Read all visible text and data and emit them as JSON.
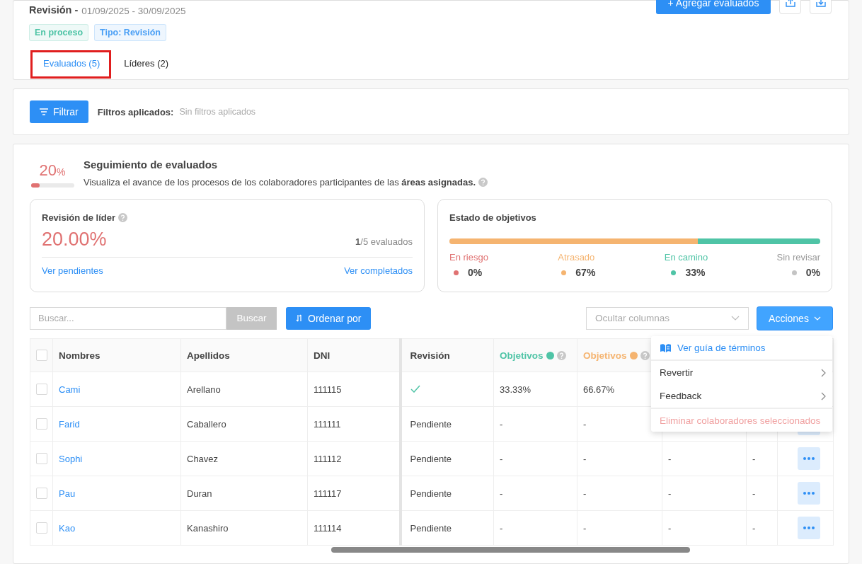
{
  "header": {
    "title": "Revisión -",
    "period": "01/09/2025 - 30/09/2025",
    "add_button": "+ Agregar evaluados"
  },
  "tags": [
    {
      "label": "En proceso",
      "color": "#4fc4a6"
    },
    {
      "label": "Tipo: Revisión",
      "color": "#4a9ff5"
    }
  ],
  "tabs": [
    {
      "label": "Evaluados (5)",
      "selected": true,
      "highlighted": true
    },
    {
      "label": "Líderes (2)",
      "selected": false,
      "highlighted": false
    }
  ],
  "filter": {
    "button": "Filtrar",
    "label": "Filtros aplicados:",
    "value": "Sin filtros aplicados"
  },
  "tracking": {
    "percent": "20",
    "percent_sign": "%",
    "level": 0.2,
    "title": "Seguimiento de evaluados",
    "description": "Visualiza el avance de los procesos de los colaboradores participantes de las **áreas asignadas.**"
  },
  "review_card": {
    "title": "Revisión de líder",
    "value": "20.00%",
    "count": "**1**/5 evaluados",
    "links": [
      "Ver pendientes",
      "Ver completados"
    ]
  },
  "objectives_card": {
    "title": "Estado de objetivos",
    "statuses": [
      {
        "label": "En riesgo",
        "value": "0%",
        "color": "#e07272"
      },
      {
        "label": "Atrasado",
        "value": "67%",
        "level": 0.67,
        "color": "#f5b470"
      },
      {
        "label": "En camino",
        "value": "33%",
        "level": 0.33,
        "color": "#4fc4a6"
      },
      {
        "label": "Sin revisar",
        "value": "0%",
        "color": "#c4c4c4"
      }
    ]
  },
  "toolbar": {
    "search_placeholder": "Buscar...",
    "search_button": "Buscar",
    "sort_button": "Ordenar por",
    "columns_placeholder": "Ocultar columnas",
    "actions_button": "Acciones"
  },
  "actions_menu": {
    "open": true,
    "items": [
      {
        "kind": "guide",
        "label": "Ver guía de términos"
      },
      {
        "kind": "submenu",
        "label": "Revertir"
      },
      {
        "kind": "submenu",
        "label": "Feedback"
      },
      {
        "kind": "danger",
        "label": "Eliminar colaboradores seleccionados"
      }
    ]
  },
  "table": {
    "all_checked": false,
    "columns": [
      {
        "label": "Nombres"
      },
      {
        "label": "Apellidos"
      },
      {
        "label": "DNI"
      },
      {
        "label": "Revisión"
      },
      {
        "label": "Objetivos",
        "color": "#4fc4a6",
        "help": true
      },
      {
        "label": "Objetivos",
        "color": "#f5b470",
        "help": true
      }
    ],
    "rows": [
      {
        "checked": false,
        "name": "Cami",
        "surname": "Arellano",
        "dni": "111115",
        "reviewed": true,
        "cells": [
          "33.33%",
          "66.67%"
        ]
      },
      {
        "checked": false,
        "name": "Farid",
        "surname": "Caballero",
        "dni": "111111",
        "reviewed": false,
        "revision": "Pendiente",
        "cells": [
          "-",
          "-"
        ],
        "menu_button": true
      },
      {
        "checked": false,
        "name": "Sophi",
        "surname": "Chavez",
        "dni": "111112",
        "reviewed": false,
        "revision": "Pendiente",
        "cells": [
          "-",
          "-",
          "-",
          "-"
        ],
        "menu_button": true
      },
      {
        "checked": false,
        "name": "Pau",
        "surname": "Duran",
        "dni": "111117",
        "reviewed": false,
        "revision": "Pendiente",
        "cells": [
          "-",
          "-",
          "-",
          "-"
        ],
        "menu_button": true
      },
      {
        "checked": false,
        "name": "Kao",
        "surname": "Kanashiro",
        "dni": "111114",
        "reviewed": false,
        "revision": "Pendiente",
        "cells": [
          "-",
          "-",
          "-",
          "-"
        ],
        "menu_button": true
      }
    ]
  }
}
